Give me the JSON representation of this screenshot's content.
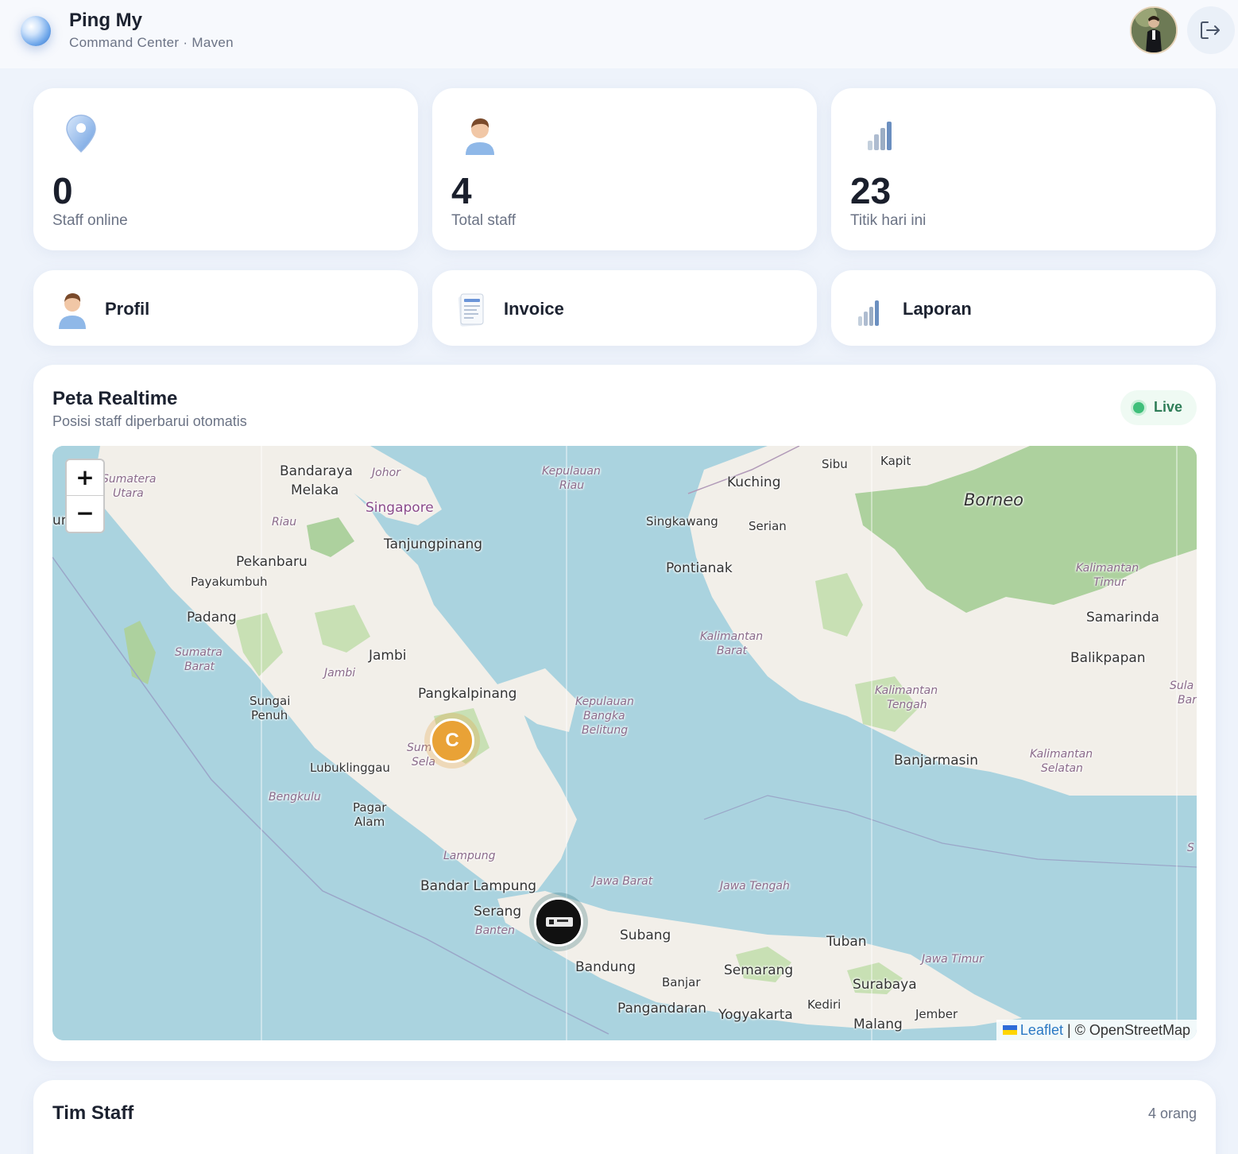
{
  "header": {
    "title": "Ping My",
    "subtitle": "Command Center · Maven",
    "logo_icon": "globe-orb-icon",
    "avatar_icon": "user-avatar-photo",
    "logout_icon": "logout-icon"
  },
  "stats": [
    {
      "icon": "location-pin-icon",
      "value": "0",
      "label": "Staff online"
    },
    {
      "icon": "person-icon",
      "value": "4",
      "label": "Total staff"
    },
    {
      "icon": "bar-chart-icon",
      "value": "23",
      "label": "Titik hari ini"
    }
  ],
  "nav": [
    {
      "icon": "person-icon",
      "label": "Profil"
    },
    {
      "icon": "document-icon",
      "label": "Invoice"
    },
    {
      "icon": "bar-chart-icon",
      "label": "Laporan"
    }
  ],
  "map": {
    "title": "Peta Realtime",
    "subtitle": "Posisi staff diperbarui otomatis",
    "live_label": "Live",
    "live_color": "#3fbf7a",
    "zoom_in_label": "+",
    "zoom_out_label": "−",
    "attribution_leaflet": "Leaflet",
    "attribution_sep": " | ",
    "attribution_osm": "© OpenStreetMap",
    "marker_cluster_letter": "C",
    "marker_cluster_color": "#e9a236",
    "labels": {
      "bandaraya_melaka": "Bandaraya",
      "melaka": "Melaka",
      "johor": "Johor",
      "singapore": "Singapore",
      "tanjungpinang": "Tanjungpinang",
      "riau": "Riau",
      "sumatera_utara_1": "Sumatera",
      "sumatera_utara_2": "Utara",
      "pekanbaru": "Pekanbaru",
      "payakumbuh": "Payakumbuh",
      "padang": "Padang",
      "sumatra_barat_1": "Sumatra",
      "sumatra_barat_2": "Barat",
      "jambi_city": "Jambi",
      "jambi_prov": "Jambi",
      "sungai_penuh_1": "Sungai",
      "sungai_penuh_2": "Penuh",
      "pangkalpinang": "Pangkalpinang",
      "lubuklinggau": "Lubuklinggau",
      "bengkulu": "Bengkulu",
      "pagar_alam_1": "Pagar",
      "pagar_alam_2": "Alam",
      "lampung": "Lampung",
      "bandar_lampung": "Bandar Lampung",
      "serang": "Serang",
      "banten": "Banten",
      "kepulauan_riau_1": "Kepulauan",
      "kepulauan_riau_2": "Riau",
      "kepulauan_bangka_1": "Kepulauan",
      "kepulauan_bangka_2": "Bangka",
      "kepulauan_bangka_3": "Belitung",
      "jawa_barat": "Jawa Barat",
      "jawa_tengah": "Jawa Tengah",
      "jawa_timur": "Jawa Timur",
      "subang": "Subang",
      "bandung": "Bandung",
      "banjar": "Banjar",
      "pangandaran": "Pangandaran",
      "yogyakarta": "Yogyakarta",
      "semarang": "Semarang",
      "tuban": "Tuban",
      "surabaya": "Surabaya",
      "kediri": "Kediri",
      "malang": "Malang",
      "jember": "Jember",
      "sibu": "Sibu",
      "kapit": "Kapit",
      "kuching": "Kuching",
      "serian": "Serian",
      "singkawang": "Singkawang",
      "borneo": "Borneo",
      "pontianak": "Pontianak",
      "kalimantan_barat_1": "Kalimantan",
      "kalimantan_barat_2": "Barat",
      "kalimantan_timur_1": "Kalimantan",
      "kalimantan_timur_2": "Timur",
      "samarinda": "Samarinda",
      "balikpapan": "Balikpapan",
      "kalimantan_tengah_1": "Kalimantan",
      "kalimantan_tengah_2": "Tengah",
      "banjarmasin": "Banjarmasin",
      "kalimantan_selatan_1": "Kalimantan",
      "kalimantan_selatan_2": "Selatan",
      "sula_1": "Sula",
      "sula_2": "Bar",
      "sum_1": "Sum",
      "sum_2": "Sela",
      "edge_un": "un",
      "edge_s": "S"
    }
  },
  "team": {
    "title": "Tim Staff",
    "count_label": "4 orang"
  }
}
